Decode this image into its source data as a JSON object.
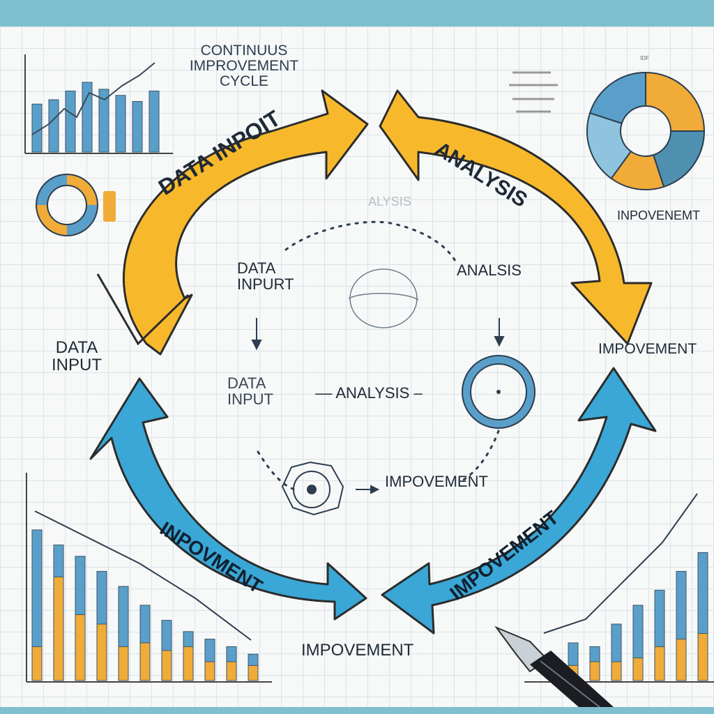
{
  "title": {
    "line1": "CONTINUUS",
    "line2": "IMPROVEMENT",
    "line3": "CYCLE"
  },
  "big_arrows": {
    "top_left": "DATA INPOIT",
    "top_right": "ANALYSIS",
    "bottom_left": "INPOVMENT",
    "bottom_right": "IMPOVEMENT"
  },
  "outer_labels": {
    "left_line1": "DATA",
    "left_line2": "INPUT",
    "right_improvement": "IMPOVEMENT",
    "bottom_improvement": "IMPOVEMENT",
    "top_right_improvement": "INPOVENEMT"
  },
  "inner_labels": {
    "ghost_analysis": "ALYSIS",
    "data_input_line1": "DATA",
    "data_input_line2": "INPURT",
    "analysis": "ANALSIS",
    "center_data_line1": "DATA",
    "center_data_line2": "INPUT",
    "center_analysis": "ANALYSIS",
    "center_improvement": "IMPOVEMENT"
  },
  "corner_marks": {
    "top_right": "IDF"
  },
  "colors": {
    "yellow": "#f7b92b",
    "yellow_dark": "#e19b10",
    "blue": "#3aa7d6",
    "blue_dark": "#1f84b5",
    "chart_blue": "#5a9fc9",
    "chart_orange": "#f0ab38",
    "ink": "#1f2a36"
  },
  "chart_data": [
    {
      "type": "bar",
      "categories": [
        "1",
        "2",
        "3",
        "4",
        "5",
        "6",
        "7",
        "8"
      ],
      "series": [
        {
          "values": [
            55,
            60,
            70,
            80,
            72,
            65,
            58,
            70
          ]
        }
      ]
    },
    {
      "type": "bar",
      "categories": [
        "1",
        "2",
        "3",
        "4",
        "5",
        "6",
        "7",
        "8",
        "9",
        "10",
        "11"
      ],
      "series": [
        {
          "values": [
            80,
            72,
            66,
            58,
            50,
            40,
            32,
            26,
            22,
            18,
            14
          ]
        },
        {
          "values": [
            18,
            55,
            35,
            30,
            18,
            20,
            16,
            18,
            10,
            10,
            8
          ]
        }
      ]
    },
    {
      "type": "bar",
      "categories": [
        "1",
        "2",
        "3",
        "4",
        "5",
        "6",
        "7",
        "8",
        "9"
      ],
      "series": [
        {
          "values": [
            20,
            18,
            30,
            40,
            48,
            58,
            68,
            80,
            90
          ]
        },
        {
          "values": [
            8,
            10,
            10,
            12,
            18,
            22,
            25,
            28,
            30
          ]
        }
      ]
    },
    {
      "type": "pie",
      "values": [
        25,
        20,
        15,
        20,
        20
      ]
    }
  ]
}
